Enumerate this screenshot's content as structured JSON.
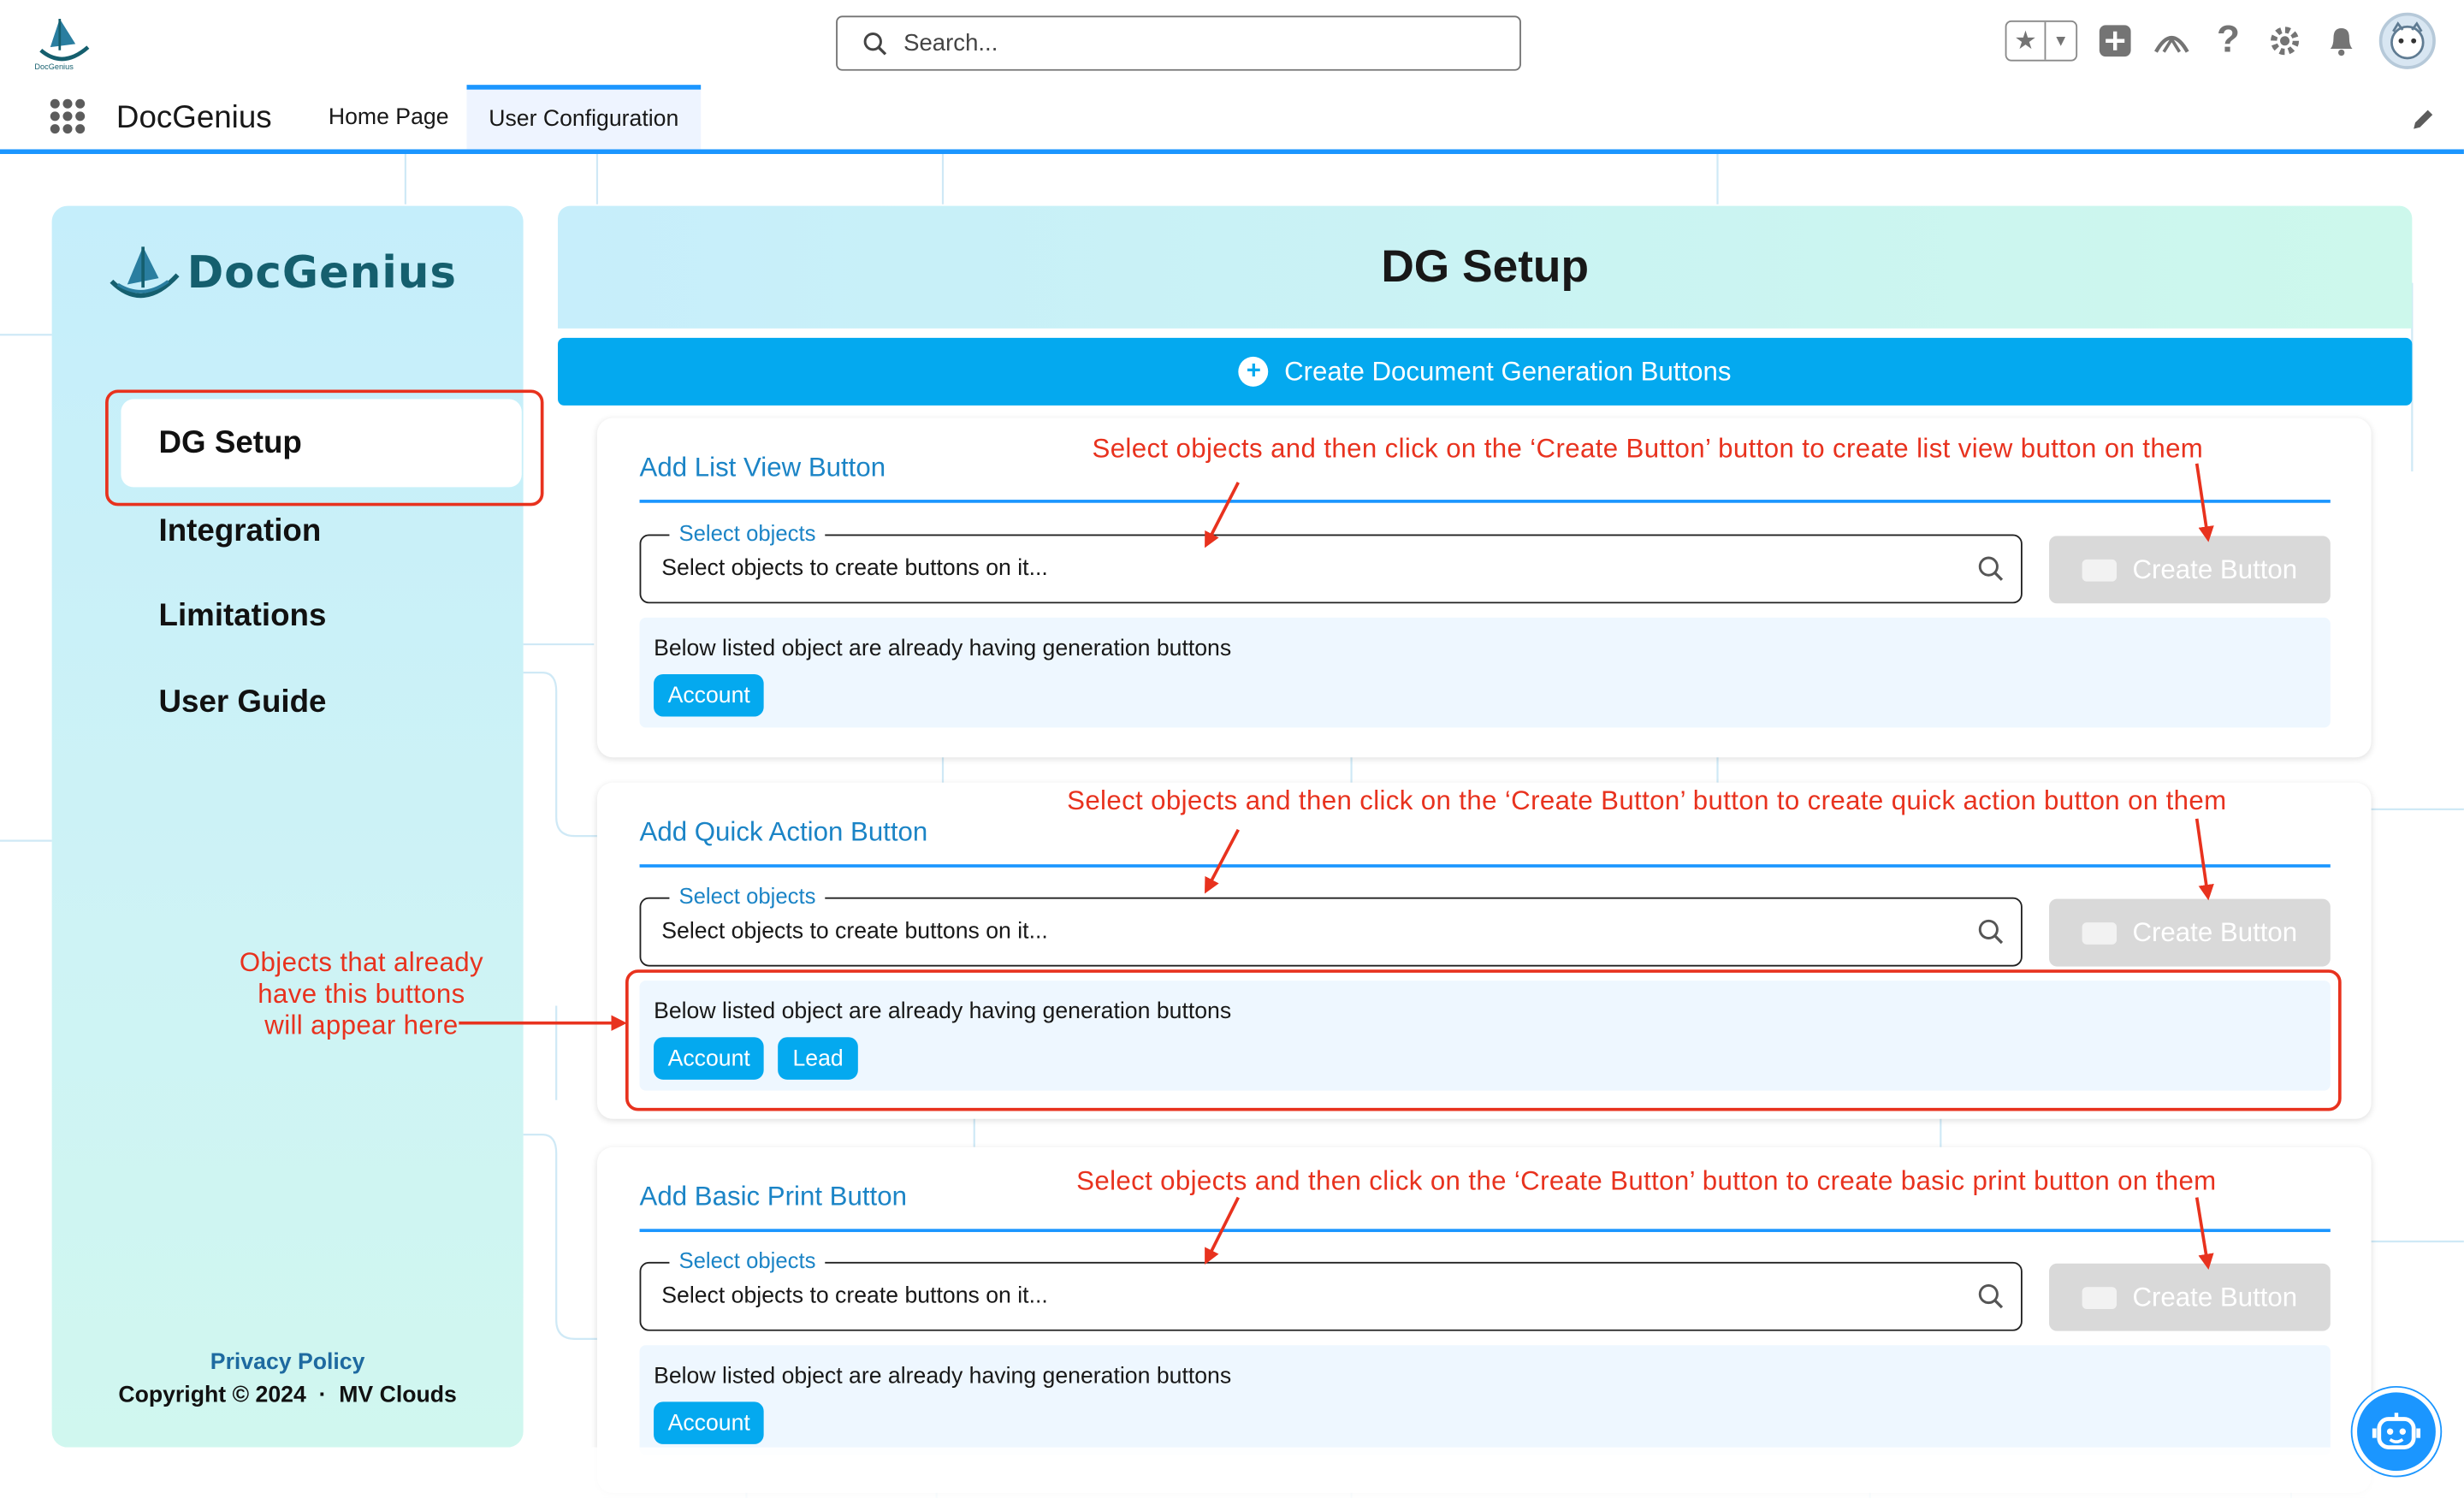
{
  "search": {
    "placeholder": "Search..."
  },
  "nav": {
    "app_name": "DocGenius",
    "tabs": [
      {
        "label": "Home Page"
      },
      {
        "label": "User Configuration"
      }
    ]
  },
  "sidebar": {
    "brand": "DocGenius",
    "items": [
      {
        "label": "DG Setup"
      },
      {
        "label": "Integration"
      },
      {
        "label": "Limitations"
      },
      {
        "label": "User Guide"
      }
    ],
    "privacy": "Privacy Policy",
    "copyright": "Copyright © 2024  ·  MV Clouds"
  },
  "main": {
    "title": "DG Setup",
    "create_bar": "Create Document Generation Buttons",
    "cards": [
      {
        "title": "Add List View Button",
        "legend": "Select objects",
        "placeholder": "Select objects to create buttons on it...",
        "button": "Create Button",
        "listed_text": "Below listed object are already having generation buttons",
        "chips": [
          "Account"
        ]
      },
      {
        "title": "Add Quick Action Button",
        "legend": "Select objects",
        "placeholder": "Select objects to create buttons on it...",
        "button": "Create Button",
        "listed_text": "Below listed object are already having generation buttons",
        "chips": [
          "Account",
          "Lead"
        ]
      },
      {
        "title": "Add Basic Print Button",
        "legend": "Select objects",
        "placeholder": "Select objects to create buttons on it...",
        "button": "Create Button",
        "listed_text": "Below listed object are already having generation buttons",
        "chips": [
          "Account"
        ]
      }
    ]
  },
  "annotations": {
    "list_view": "Select objects and then click on the ‘Create Button’ button to create list view button on them",
    "quick_action": "Select objects and then click on the ‘Create Button’ button to create quick action button on them",
    "basic_print": "Select objects and then click on the ‘Create Button’ button to create basic print button on them",
    "objects": "Objects that already have this buttons will appear here"
  },
  "colors": {
    "accent": "#04a9ef",
    "brand_blue": "#1b96ff",
    "annotation_red": "#e8321e",
    "title_blue": "#1b84c6"
  },
  "icons": [
    "docgenius-logo-icon",
    "search-icon",
    "favorites-star-icon",
    "add-icon",
    "trailhead-icon",
    "help-icon",
    "gear-icon",
    "bell-icon",
    "avatar",
    "app-launcher-icon",
    "pencil-icon",
    "plus-circle-icon",
    "create-button-icon",
    "chatbot-icon"
  ]
}
